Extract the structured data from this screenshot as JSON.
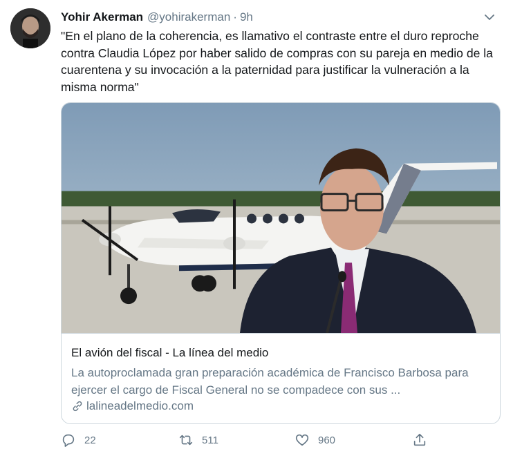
{
  "tweet": {
    "author_name": "Yohir Akerman",
    "handle": "@yohirakerman",
    "separator": "·",
    "time": "9h",
    "text": "\"En el plano de la coherencia, es llamativo el contraste entre el duro reproche contra Claudia López por haber salido de compras con su pareja en medio de la cuarentena y su invocación a la paternidad para justificar la vulneración a la misma norma\""
  },
  "card": {
    "title": "El avión del fiscal - La línea del medio",
    "description": "La autoproclamada gran preparación académica de Francisco Barbosa para ejercer el cargo de Fiscal General no se compadece con sus ...",
    "link": "lalineadelmedio.com"
  },
  "actions": {
    "replies": "22",
    "retweets": "511",
    "likes": "960"
  },
  "icons": {
    "caret": "chevron-down-icon",
    "link": "link-icon",
    "reply": "reply-icon",
    "retweet": "retweet-icon",
    "like": "heart-icon",
    "share": "share-icon"
  },
  "colors": {
    "text": "#14171a",
    "secondary": "#657786",
    "border": "#ccd6dd"
  }
}
